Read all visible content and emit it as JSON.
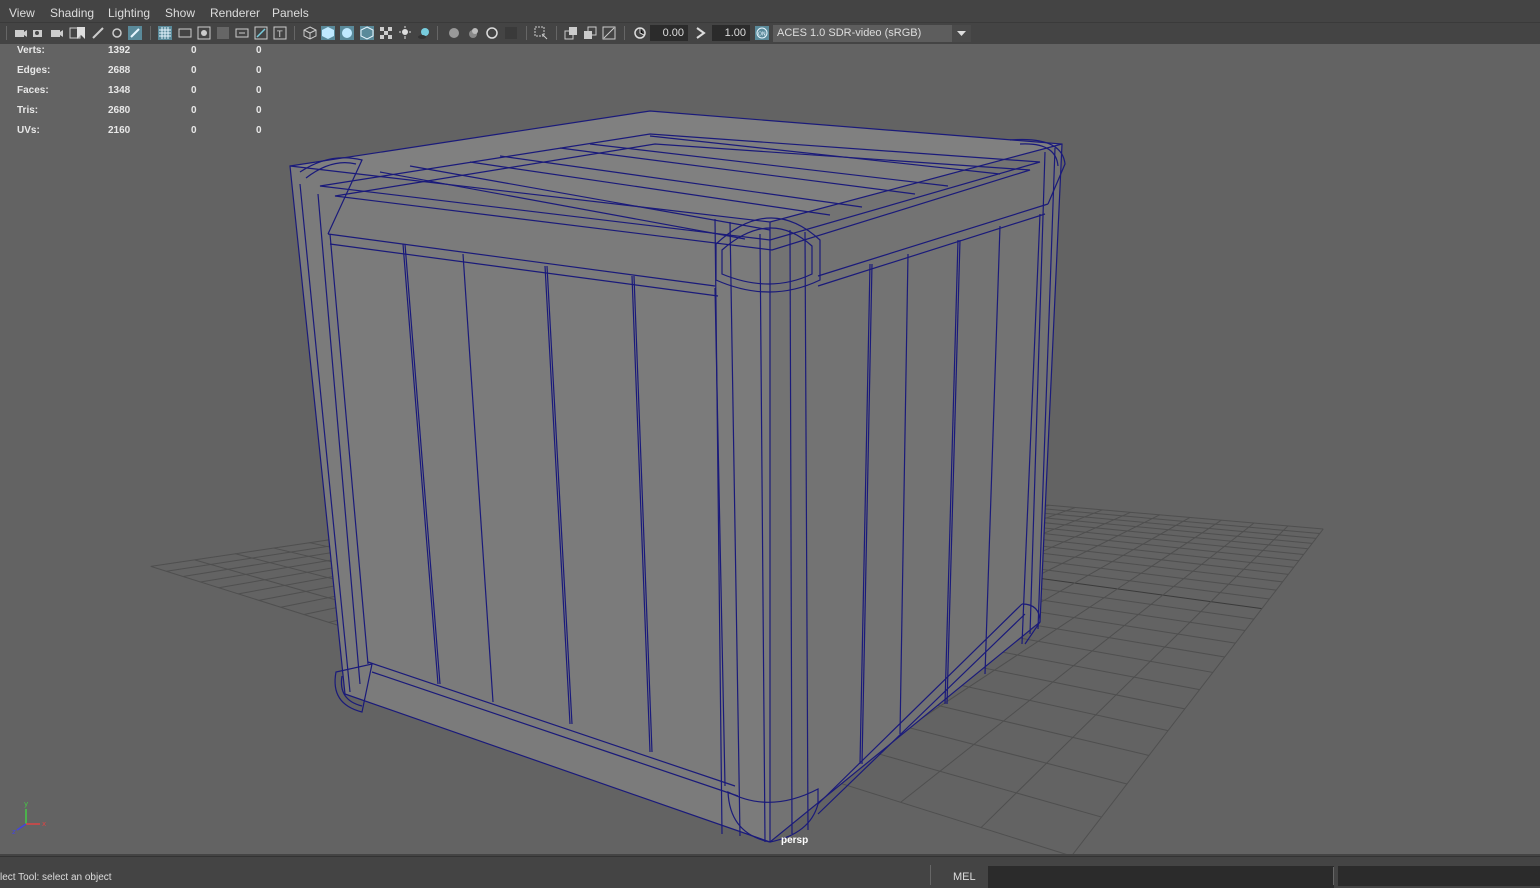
{
  "menus": [
    "View",
    "Shading",
    "Lighting",
    "Show",
    "Renderer",
    "Panels"
  ],
  "toolbar": {
    "exposure_value": "0.00",
    "gamma_value": "1.00",
    "colorspace_label": "ACES 1.0 SDR-video (sRGB)"
  },
  "hud": {
    "rows": [
      {
        "label": "Verts:",
        "total": "1392",
        "selected": "0",
        "highlighted": "0"
      },
      {
        "label": "Edges:",
        "total": "2688",
        "selected": "0",
        "highlighted": "0"
      },
      {
        "label": "Faces:",
        "total": "1348",
        "selected": "0",
        "highlighted": "0"
      },
      {
        "label": "Tris:",
        "total": "2680",
        "selected": "0",
        "highlighted": "0"
      },
      {
        "label": "UVs:",
        "total": "2160",
        "selected": "0",
        "highlighted": "0"
      }
    ]
  },
  "viewport": {
    "camera_label": "persp",
    "background_color": "#636363",
    "wire_color": "#1a1a7a",
    "face_color": "#7a7a7a"
  },
  "statusbar": {
    "help_text": "lect Tool: select an object",
    "mel_label": "MEL"
  }
}
